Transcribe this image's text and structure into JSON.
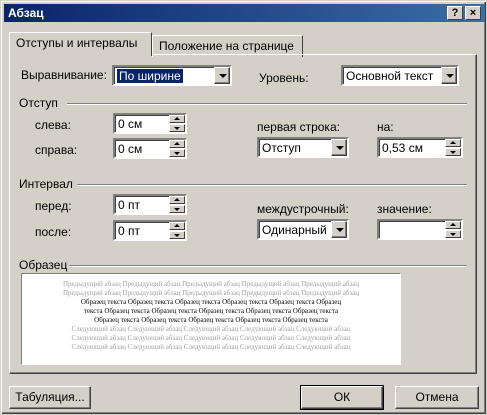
{
  "window": {
    "title": "Абзац",
    "help_label": "?",
    "close_label": "×"
  },
  "tabs": [
    {
      "label": "Отступы и интервалы",
      "active": true
    },
    {
      "label": "Положение на странице",
      "active": false
    }
  ],
  "alignment": {
    "label": "Выравнивание:",
    "value": "По ширине"
  },
  "level": {
    "label": "Уровень:",
    "value": "Основной текст"
  },
  "indent": {
    "group_label": "Отступ",
    "left_label": "слева:",
    "left_value": "0 см",
    "right_label": "справа:",
    "right_value": "0 см",
    "first_line_label": "первая строка:",
    "first_line_value": "Отступ",
    "by_label": "на:",
    "by_value": "0,53 см"
  },
  "spacing": {
    "group_label": "Интервал",
    "before_label": "перед:",
    "before_value": "0 пт",
    "after_label": "после:",
    "after_value": "0 пт",
    "line_label": "междустрочный:",
    "line_value": "Одинарный",
    "at_label": "значение:",
    "at_value": ""
  },
  "preview": {
    "group_label": "Образец",
    "prev_lines": [
      "Предыдущий абзац Предыдущий абзац Предыдущий абзац Предыдущий абзац Предыдущий абзац",
      "Предыдущий абзац Предыдущий абзац Предыдущий абзац Предыдущий абзац Предыдущий абзац"
    ],
    "sample_lines": [
      "Образец текста Образец текста Образец текста Образец текста Образец текста Образец",
      "текста Образец текста Образец текста Образец текста Образец текста Образец текста",
      "Образец текста Образец текста Образец текста Образец текста Образец текста"
    ],
    "next_lines": [
      "Следующий абзац Следующий абзац Следующий абзац Следующий абзац Следующий абзац",
      "Следующий абзац Следующий абзац Следующий абзац Следующий абзац Следующий абзац",
      "Следующий абзац Следующий абзац Следующий абзац Следующий абзац Следующий абзац"
    ]
  },
  "buttons": {
    "tabs_label": "Табуляция...",
    "ok_label": "ОК",
    "cancel_label": "Отмена"
  }
}
